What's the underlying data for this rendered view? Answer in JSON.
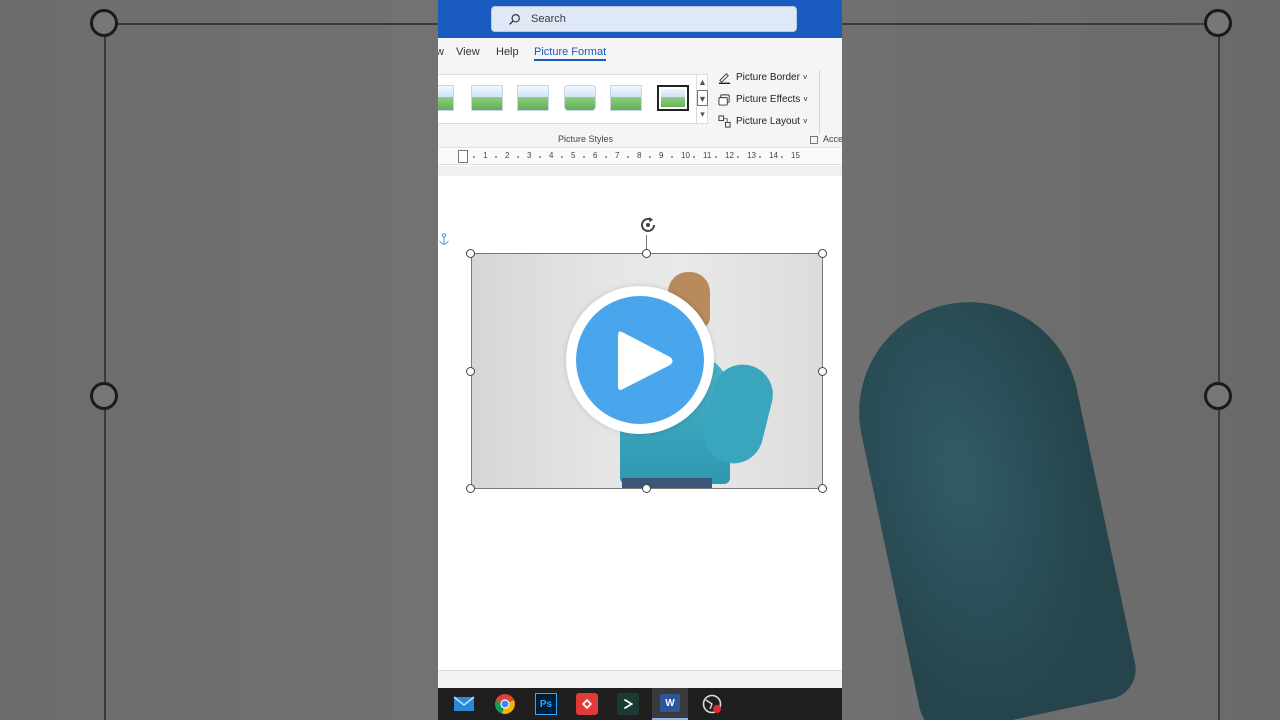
{
  "search": {
    "placeholder": "Search"
  },
  "menu": {
    "partial": "w",
    "view": "View",
    "help": "Help",
    "picture_format": "Picture Format"
  },
  "ribbon": {
    "picture_border": "Picture Border",
    "picture_effects": "Picture Effects",
    "picture_layout": "Picture Layout",
    "group_label": "Picture Styles",
    "next_group_label": "Acce",
    "caret": "˅"
  },
  "ruler": {
    "ticks": [
      "1",
      "2",
      "3",
      "4",
      "5",
      "6",
      "7",
      "8",
      "9",
      "10",
      "11",
      "12",
      "13",
      "14",
      "15"
    ]
  },
  "taskbar": {
    "apps": [
      "mail-icon",
      "chrome-icon",
      "photoshop-icon",
      "anydesk-icon",
      "capcut-icon",
      "word-icon",
      "screen-recorder-icon"
    ],
    "photoshop": "Ps",
    "word": "W"
  },
  "colors": {
    "titlebar": "#185abd",
    "play": "#4aa6ec",
    "accent": "#185abd"
  }
}
